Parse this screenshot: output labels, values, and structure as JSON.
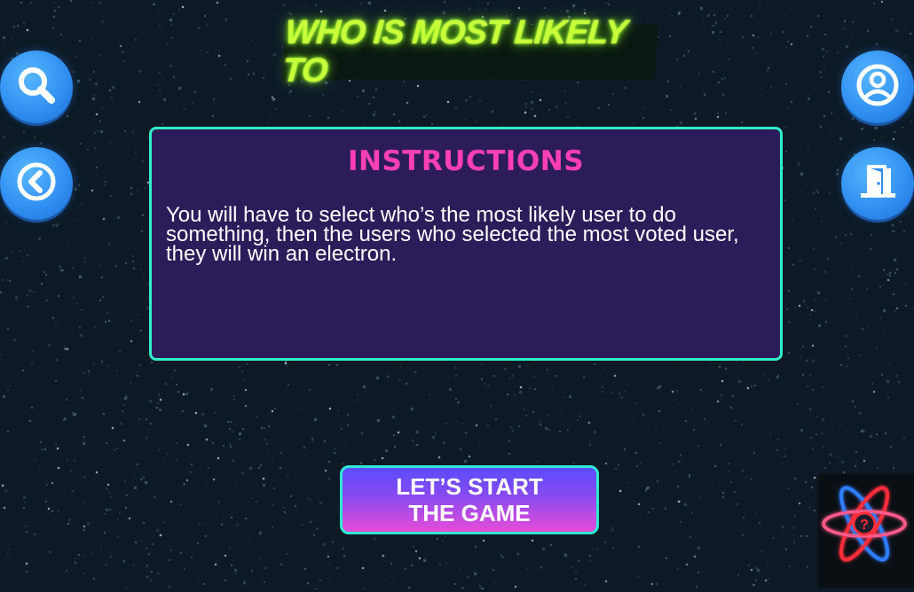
{
  "header": {
    "title": "WHO IS MOST LIKELY TO"
  },
  "instructions": {
    "heading": "INSTRUCTIONS",
    "body": "You will have to select who’s the most likely user to do something, then the users who selected the most voted user, they will win an electron."
  },
  "actions": {
    "start_label": "LET’S START THE GAME"
  },
  "icons": {
    "search": "search-icon",
    "back": "back-arrow-icon",
    "profile": "user-profile-icon",
    "exit": "exit-door-icon",
    "logo": "atom-logo-icon"
  },
  "colors": {
    "background": "#0d1a26",
    "title_neon": "#c8ff3a",
    "panel": "#2d1c5a",
    "panel_border": "#2ff0c8",
    "heading": "#ff3fb5",
    "button_blue": "#2f8df0",
    "start_gradient_top": "#5a4cff",
    "start_gradient_bottom": "#e74cd8",
    "logo_red": "#ff2d3a",
    "logo_blue": "#2f7dff"
  }
}
